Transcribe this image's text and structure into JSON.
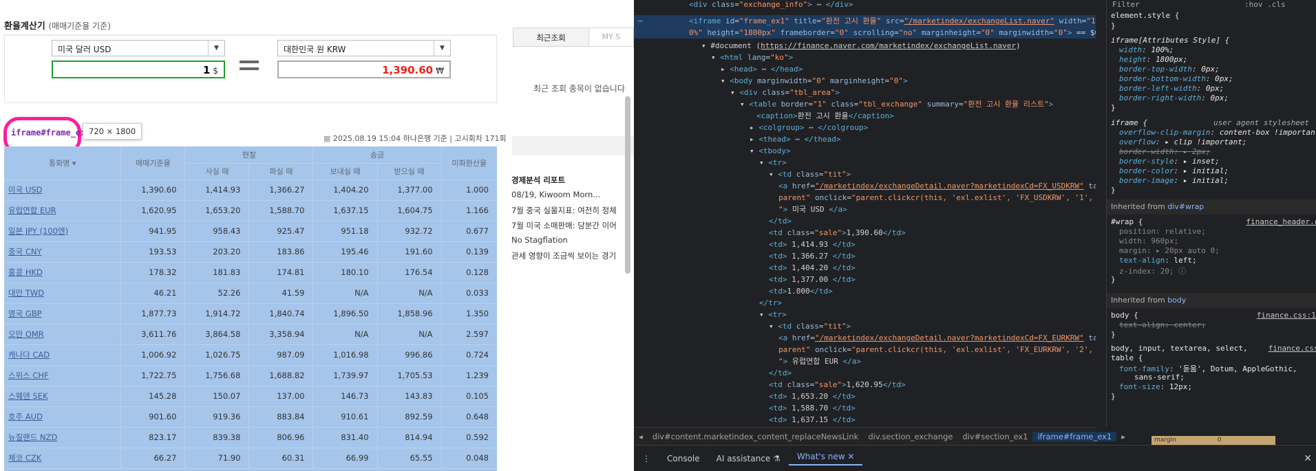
{
  "calculator": {
    "title": "환율계산기",
    "subtitle": "(매매기준율 기준)",
    "from_currency": "미국 달러 USD",
    "to_currency": "대한민국 원 KRW",
    "from_amount": "1",
    "from_unit": "$",
    "to_amount": "1,390.60",
    "to_unit": "₩"
  },
  "inspect_tag": {
    "label": "iframe#frame_ex1",
    "size": "720 × 1800"
  },
  "rate_info": {
    "text": "2025.08.19 15:04 하나은행 기준 | 고시회차 171회"
  },
  "table": {
    "head1": [
      "통화명",
      "매매기준율",
      "현찰",
      "송금",
      "미화환산율"
    ],
    "head2": [
      "사실 때",
      "파실 때",
      "보내실 때",
      "받으실 때"
    ],
    "rows": [
      [
        "미국 USD",
        "1,390.60",
        "1,414.93",
        "1,366.27",
        "1,404.20",
        "1,377.00",
        "1.000"
      ],
      [
        "유럽연합 EUR",
        "1,620.95",
        "1,653.20",
        "1,588.70",
        "1,637.15",
        "1,604.75",
        "1.166"
      ],
      [
        "일본 JPY (100엔)",
        "941.95",
        "958.43",
        "925.47",
        "951.18",
        "932.72",
        "0.677"
      ],
      [
        "중국 CNY",
        "193.53",
        "203.20",
        "183.86",
        "195.46",
        "191.60",
        "0.139"
      ],
      [
        "홍콩 HKD",
        "178.32",
        "181.83",
        "174.81",
        "180.10",
        "176.54",
        "0.128"
      ],
      [
        "대만 TWD",
        "46.21",
        "52.26",
        "41.59",
        "N/A",
        "N/A",
        "0.033"
      ],
      [
        "영국 GBP",
        "1,877.73",
        "1,914.72",
        "1,840.74",
        "1,896.50",
        "1,858.96",
        "1.350"
      ],
      [
        "오만 OMR",
        "3,611.76",
        "3,864.58",
        "3,358.94",
        "N/A",
        "N/A",
        "2.597"
      ],
      [
        "캐나다 CAD",
        "1,006.92",
        "1,026.75",
        "987.09",
        "1,016.98",
        "996.86",
        "0.724"
      ],
      [
        "스위스 CHF",
        "1,722.75",
        "1,756.68",
        "1,688.82",
        "1,739.97",
        "1,705.53",
        "1.239"
      ],
      [
        "스웨덴 SEK",
        "145.28",
        "150.07",
        "137.00",
        "146.73",
        "143.83",
        "0.105"
      ],
      [
        "호주 AUD",
        "901.60",
        "919.36",
        "883.84",
        "910.61",
        "892.59",
        "0.648"
      ],
      [
        "뉴질랜드 NZD",
        "823.17",
        "839.38",
        "806.96",
        "831.40",
        "814.94",
        "0.592"
      ],
      [
        "체코 CZK",
        "66.27",
        "71.90",
        "60.31",
        "66.99",
        "65.55",
        "0.048"
      ]
    ]
  },
  "side": {
    "tab_recent": "최근조회",
    "tab_my": "MY S",
    "empty": "최근 조회 종목이 없습니다",
    "report_title": "경제분석 리포트",
    "reports": [
      "08/19, Kiwoom Morn...",
      "7월 중국 실물지표: 여전히 정체",
      "7월 미국 소매판매: 당분간 이어",
      "No Stagflation",
      "관세 영향이 조금씩 보이는 경기"
    ]
  },
  "devtools": {
    "lines": [
      {
        "indent": 0,
        "html": "<span class=\"txt\">&lt;div class=\"exchange_info\"&gt;</span> <span class=\"txt\">⋯</span> <span class=\"tagc\">&lt;/div&gt;</span>"
      },
      {
        "indent": 0,
        "html": ""
      }
    ],
    "selected_line1": "<iframe id=\"frame_ex1\" title=\"환전 고시 환율\" src=\"/marketindex/exchangeList.naver\" width=\"10",
    "selected_line2": "0%\" height=\"1800px\" frameborder=\"0\" scrolling=\"no\" marginheight=\"0\" marginwidth=\"0\"> == $0",
    "breadcrumbs": [
      "div#content.marketindex_content_replaceNewsLink",
      "div.section_exchange",
      "div#section_ex1",
      "iframe#frame_ex1"
    ],
    "drawer_tabs": [
      "Console",
      "AI assistance",
      "What's new"
    ],
    "styles_filter": "Filter",
    "styles_toolbar": ":hov .cls",
    "margin_label": "margin",
    "margin_value": "0"
  }
}
